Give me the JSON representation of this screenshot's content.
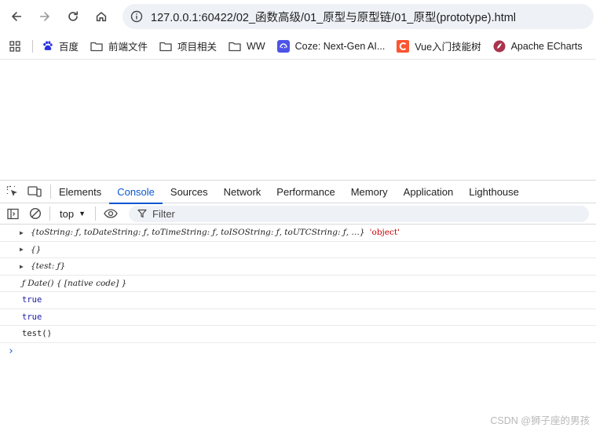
{
  "browser": {
    "url": "127.0.0.1:60422/02_函数高级/01_原型与原型链/01_原型(prototype).html"
  },
  "bookmarks": [
    {
      "label": "百度",
      "icon": "baidu-paw-icon"
    },
    {
      "label": "前端文件",
      "icon": "folder-icon"
    },
    {
      "label": "项目相关",
      "icon": "folder-icon"
    },
    {
      "label": "WW",
      "icon": "folder-icon"
    },
    {
      "label": "Coze: Next-Gen AI...",
      "icon": "coze-icon"
    },
    {
      "label": "Vue入门技能树",
      "icon": "csdn-icon"
    },
    {
      "label": "Apache ECharts",
      "icon": "echarts-icon"
    }
  ],
  "devtools": {
    "tabs": [
      "Elements",
      "Console",
      "Sources",
      "Network",
      "Performance",
      "Memory",
      "Application",
      "Lighthouse"
    ],
    "active_tab": "Console",
    "context": "top",
    "filter_placeholder": "Filter"
  },
  "console": {
    "line1_object": "{toString: ƒ, toDateString: ƒ, toTimeString: ƒ, toISOString: ƒ, toUTCString: ƒ,  …}",
    "line1_string": "'object'",
    "line2_object": "{}",
    "line3_object": "{test: ƒ}",
    "line4_fn": "ƒ Date() { [native code] }",
    "line5": "true",
    "line6": "true",
    "line7": "test()"
  },
  "watermark": "CSDN @狮子座的男孩",
  "colors": {
    "accent": "#0b57d0",
    "string": "#c80000",
    "boolean": "#1a1aa6"
  }
}
